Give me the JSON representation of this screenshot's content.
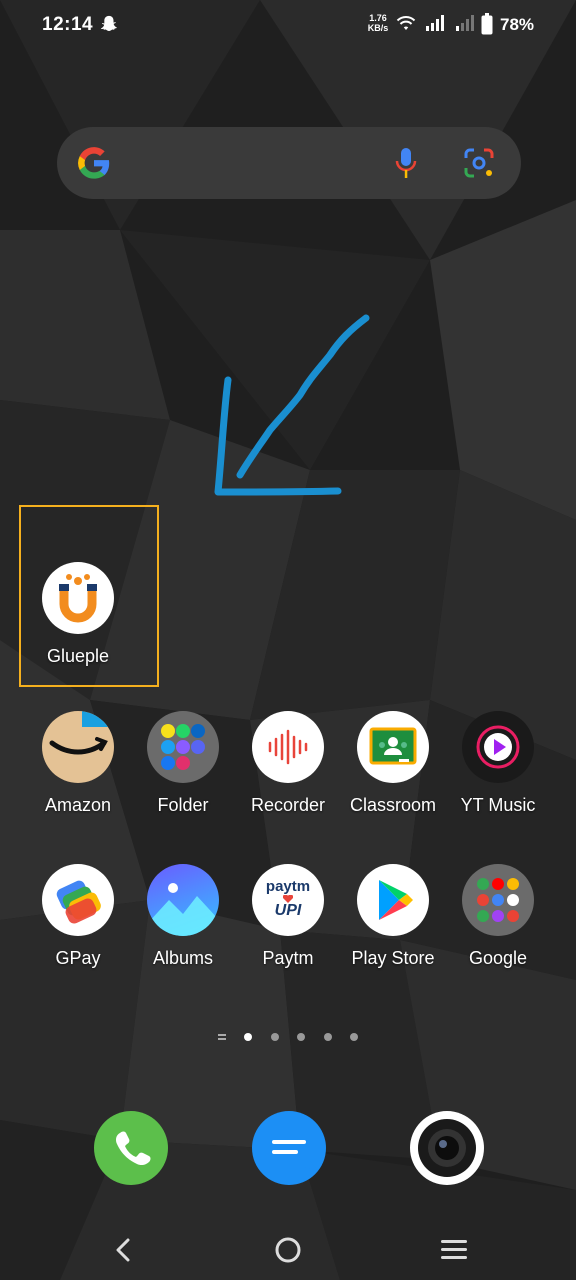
{
  "status_bar": {
    "time": "12:14",
    "net_speed_value": "1.76",
    "net_speed_unit": "KB/s",
    "battery": "78%"
  },
  "search_bar": {
    "icons": [
      "google-logo",
      "mic-icon",
      "lens-icon"
    ]
  },
  "highlighted_app": {
    "label": "Glueple",
    "highlight_color": "#f5b01e"
  },
  "annotation": {
    "arrow_color": "#1a8fd0"
  },
  "apps_row1": [
    {
      "label": "Amazon"
    },
    {
      "label": "Folder"
    },
    {
      "label": "Recorder"
    },
    {
      "label": "Classroom"
    },
    {
      "label": "YT Music"
    }
  ],
  "apps_row2": [
    {
      "label": "GPay"
    },
    {
      "label": "Albums"
    },
    {
      "label": "Paytm"
    },
    {
      "label": "Play Store"
    },
    {
      "label": "Google"
    }
  ],
  "paytm_icon": {
    "line1": "paytm",
    "line2": "UPI"
  },
  "page_indicator": {
    "pages": 5,
    "current": 1
  },
  "dock": [
    "phone",
    "messages",
    "camera"
  ],
  "nav_bar": [
    "back",
    "home",
    "menu"
  ]
}
